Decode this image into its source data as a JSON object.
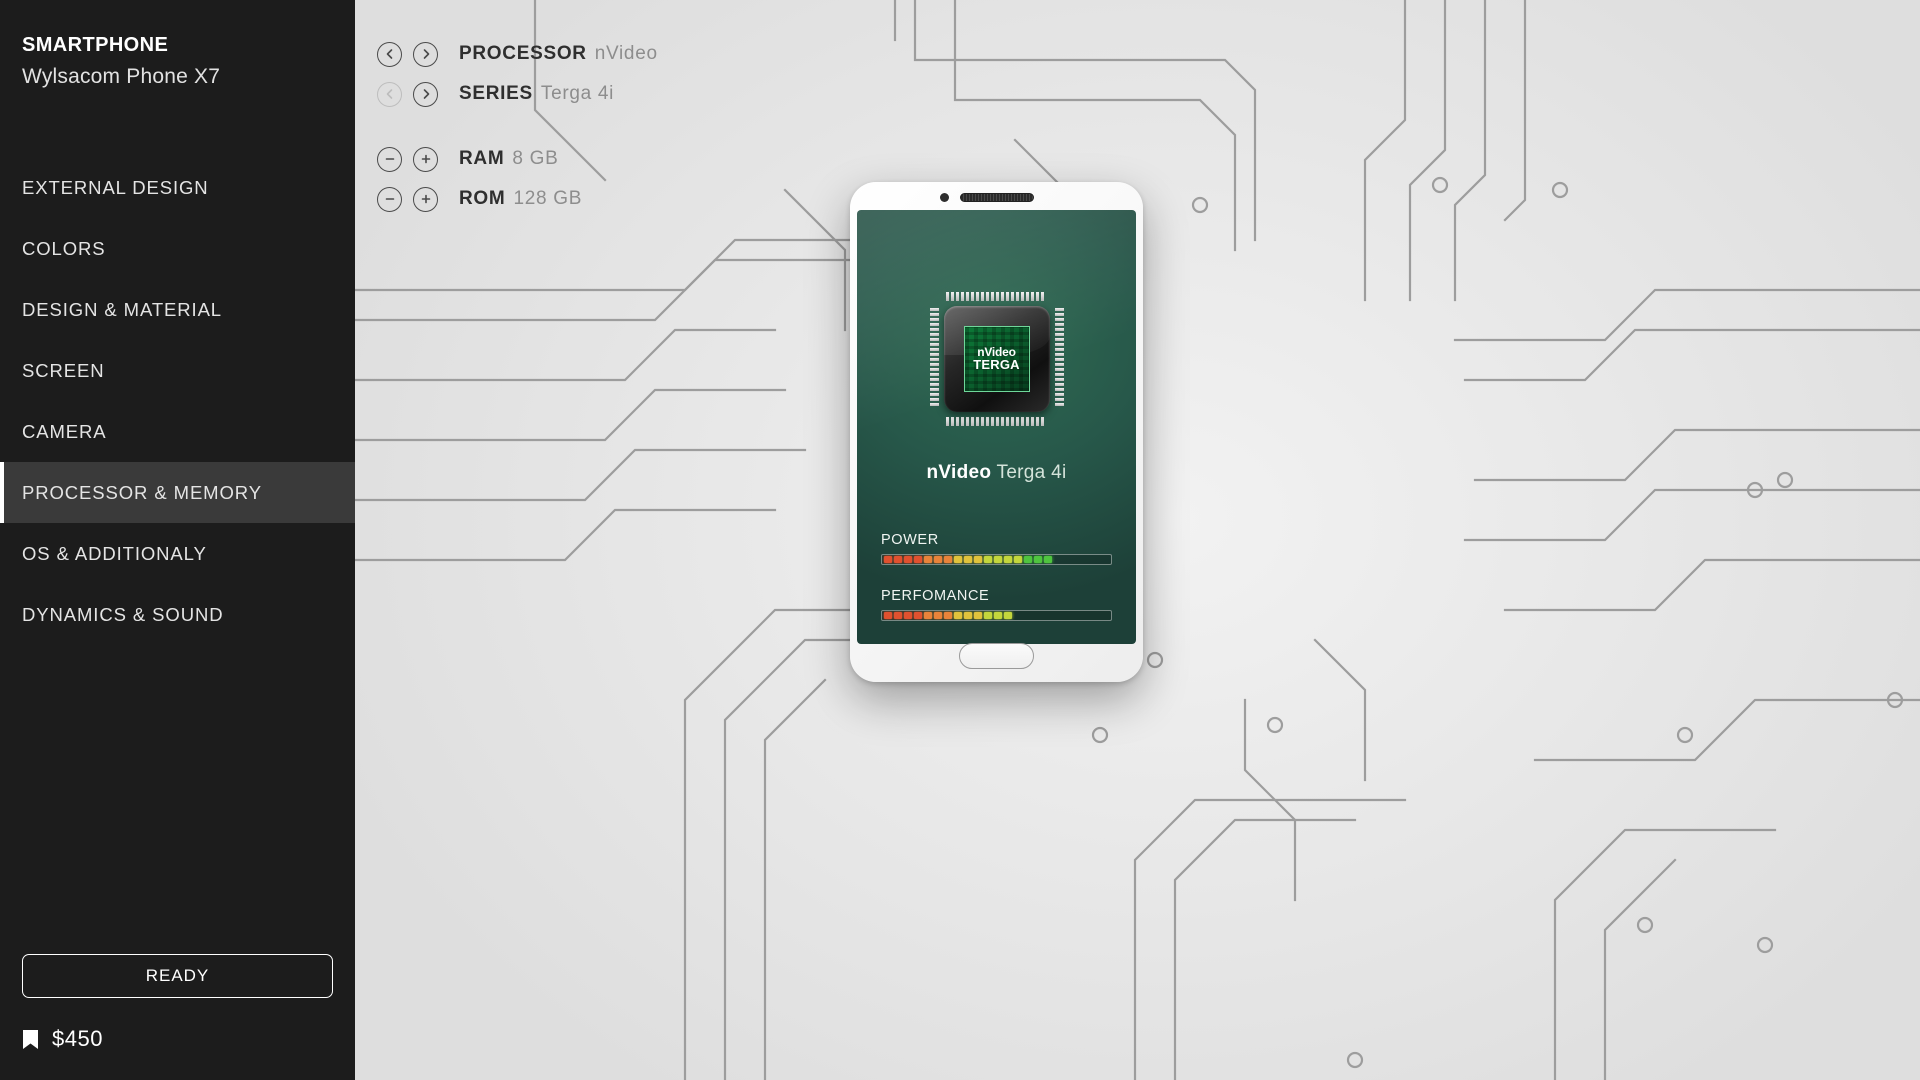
{
  "sidebar": {
    "title": "SMARTPHONE",
    "subtitle": "Wylsacom Phone X7",
    "items": [
      {
        "label": "EXTERNAL DESIGN",
        "active": false
      },
      {
        "label": "COLORS",
        "active": false
      },
      {
        "label": "DESIGN & MATERIAL",
        "active": false
      },
      {
        "label": "SCREEN",
        "active": false
      },
      {
        "label": "CAMERA",
        "active": false
      },
      {
        "label": "PROCESSOR & MEMORY",
        "active": true
      },
      {
        "label": "OS & ADDITIONALY",
        "active": false
      },
      {
        "label": "DYNAMICS & SOUND",
        "active": false
      }
    ],
    "ready_label": "READY",
    "price": "$450",
    "price_icon": "price-tag-icon"
  },
  "specs": {
    "selectors": [
      {
        "label": "PROCESSOR",
        "value": "nVideo",
        "prev_icon": "chevron-left-icon",
        "next_icon": "chevron-right-icon",
        "prev_disabled": false
      },
      {
        "label": "SERIES",
        "value": "Terga 4i",
        "prev_icon": "chevron-left-icon",
        "next_icon": "chevron-right-icon",
        "prev_disabled": true
      }
    ],
    "steppers": [
      {
        "label": "RAM",
        "value": "8 GB",
        "minus_icon": "minus-circle-icon",
        "plus_icon": "plus-circle-icon"
      },
      {
        "label": "ROM",
        "value": "128 GB",
        "minus_icon": "minus-circle-icon",
        "plus_icon": "plus-circle-icon"
      }
    ]
  },
  "phone": {
    "camera_icon": "front-camera-icon",
    "speaker_icon": "earpiece-speaker-icon",
    "home_button_icon": "home-button-icon",
    "chip": {
      "brand": "nVideo",
      "model": "TERGA"
    },
    "model_brand": "nVideo",
    "model_name": "Terga 4i",
    "meters": [
      {
        "label": "POWER",
        "lit": 17,
        "total": 22
      },
      {
        "label": "PERFOMANCE",
        "lit": 13,
        "total": 22
      }
    ]
  },
  "colors": {
    "sidebar_bg": "#1c1c1c",
    "active_item_bg": "#3a3a3a",
    "accent_bar": "#ffffff",
    "canvas_bg": "#e9e9e9",
    "circuit_line": "#9a9a9a",
    "screen_green": "#2f6b52",
    "label_dark": "#2f2f2f",
    "value_gray": "#8d8d8d"
  }
}
